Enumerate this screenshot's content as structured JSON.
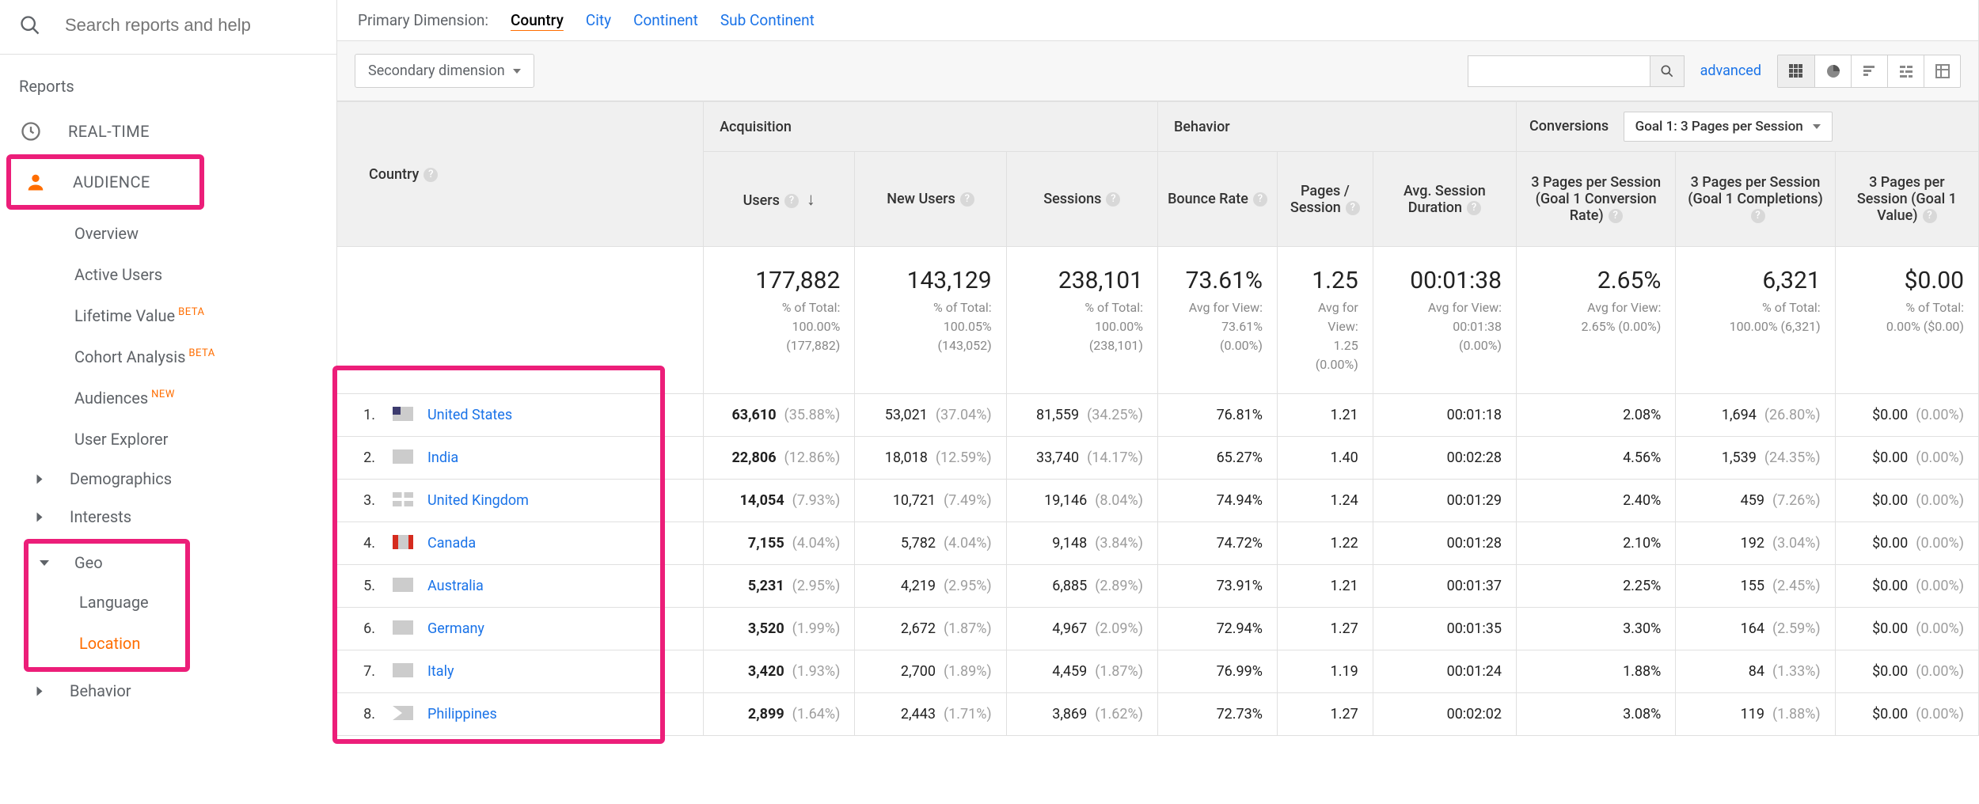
{
  "sidebar": {
    "search_placeholder": "Search reports and help",
    "reports_label": "Reports",
    "sections": {
      "realtime": "REAL-TIME",
      "audience": "AUDIENCE"
    },
    "audience_items": [
      {
        "label": "Overview",
        "badge": ""
      },
      {
        "label": "Active Users",
        "badge": ""
      },
      {
        "label": "Lifetime Value",
        "badge": "BETA"
      },
      {
        "label": "Cohort Analysis",
        "badge": "BETA"
      },
      {
        "label": "Audiences",
        "badge": "NEW"
      },
      {
        "label": "User Explorer",
        "badge": ""
      }
    ],
    "audience_expanders": [
      {
        "label": "Demographics"
      },
      {
        "label": "Interests"
      }
    ],
    "geo": {
      "label": "Geo",
      "items": [
        {
          "label": "Language"
        },
        {
          "label": "Location"
        }
      ]
    },
    "behavior_label": "Behavior"
  },
  "dimensions": {
    "label": "Primary Dimension:",
    "items": [
      "Country",
      "City",
      "Continent",
      "Sub Continent"
    ],
    "active": "Country"
  },
  "toolbar": {
    "secondary_dimension": "Secondary dimension",
    "advanced": "advanced"
  },
  "table": {
    "country_header": "Country",
    "groups": [
      "Acquisition",
      "Behavior",
      "Conversions"
    ],
    "goal_selected": "Goal 1: 3 Pages per Session",
    "metrics": [
      "Users",
      "New Users",
      "Sessions",
      "Bounce Rate",
      "Pages / Session",
      "Avg. Session Duration",
      "3 Pages per Session (Goal 1 Conversion Rate)",
      "3 Pages per Session (Goal 1 Completions)",
      "3 Pages per Session (Goal 1 Value)"
    ],
    "summary": [
      {
        "big": "177,882",
        "sub1": "% of Total:",
        "sub2": "100.00%",
        "sub3": "(177,882)"
      },
      {
        "big": "143,129",
        "sub1": "% of Total:",
        "sub2": "100.05%",
        "sub3": "(143,052)"
      },
      {
        "big": "238,101",
        "sub1": "% of Total:",
        "sub2": "100.00%",
        "sub3": "(238,101)"
      },
      {
        "big": "73.61%",
        "sub1": "Avg for View:",
        "sub2": "73.61%",
        "sub3": "(0.00%)"
      },
      {
        "big": "1.25",
        "sub1": "Avg for View:",
        "sub2": "1.25",
        "sub3": "(0.00%)"
      },
      {
        "big": "00:01:38",
        "sub1": "Avg for View:",
        "sub2": "00:01:38",
        "sub3": "(0.00%)"
      },
      {
        "big": "2.65%",
        "sub1": "Avg for View:",
        "sub2": "2.65% (0.00%)",
        "sub3": ""
      },
      {
        "big": "6,321",
        "sub1": "% of Total:",
        "sub2": "100.00% (6,321)",
        "sub3": ""
      },
      {
        "big": "$0.00",
        "sub1": "% of Total:",
        "sub2": "0.00% ($0.00)",
        "sub3": ""
      }
    ],
    "rows": [
      {
        "rank": "1.",
        "flag": "flag-us",
        "country": "United States",
        "users": "63,610",
        "users_pct": "(35.88%)",
        "nu": "53,021",
        "nu_pct": "(37.04%)",
        "sess": "81,559",
        "sess_pct": "(34.25%)",
        "br": "76.81%",
        "pps": "1.21",
        "dur": "00:01:18",
        "cr": "2.08%",
        "comp": "1,694",
        "comp_pct": "(26.80%)",
        "val": "$0.00",
        "val_pct": "(0.00%)"
      },
      {
        "rank": "2.",
        "flag": "flag-in",
        "country": "India",
        "users": "22,806",
        "users_pct": "(12.86%)",
        "nu": "18,018",
        "nu_pct": "(12.59%)",
        "sess": "33,740",
        "sess_pct": "(14.17%)",
        "br": "65.27%",
        "pps": "1.40",
        "dur": "00:02:28",
        "cr": "4.56%",
        "comp": "1,539",
        "comp_pct": "(24.35%)",
        "val": "$0.00",
        "val_pct": "(0.00%)"
      },
      {
        "rank": "3.",
        "flag": "flag-gb",
        "country": "United Kingdom",
        "users": "14,054",
        "users_pct": "(7.93%)",
        "nu": "10,721",
        "nu_pct": "(7.49%)",
        "sess": "19,146",
        "sess_pct": "(8.04%)",
        "br": "74.94%",
        "pps": "1.24",
        "dur": "00:01:29",
        "cr": "2.40%",
        "comp": "459",
        "comp_pct": "(7.26%)",
        "val": "$0.00",
        "val_pct": "(0.00%)"
      },
      {
        "rank": "4.",
        "flag": "flag-ca",
        "country": "Canada",
        "users": "7,155",
        "users_pct": "(4.04%)",
        "nu": "5,782",
        "nu_pct": "(4.04%)",
        "sess": "9,148",
        "sess_pct": "(3.84%)",
        "br": "74.72%",
        "pps": "1.22",
        "dur": "00:01:28",
        "cr": "2.10%",
        "comp": "192",
        "comp_pct": "(3.04%)",
        "val": "$0.00",
        "val_pct": "(0.00%)"
      },
      {
        "rank": "5.",
        "flag": "flag-au",
        "country": "Australia",
        "users": "5,231",
        "users_pct": "(2.95%)",
        "nu": "4,219",
        "nu_pct": "(2.95%)",
        "sess": "6,885",
        "sess_pct": "(2.89%)",
        "br": "73.91%",
        "pps": "1.21",
        "dur": "00:01:37",
        "cr": "2.25%",
        "comp": "155",
        "comp_pct": "(2.45%)",
        "val": "$0.00",
        "val_pct": "(0.00%)"
      },
      {
        "rank": "6.",
        "flag": "flag-de",
        "country": "Germany",
        "users": "3,520",
        "users_pct": "(1.99%)",
        "nu": "2,672",
        "nu_pct": "(1.87%)",
        "sess": "4,967",
        "sess_pct": "(2.09%)",
        "br": "72.94%",
        "pps": "1.27",
        "dur": "00:01:35",
        "cr": "3.30%",
        "comp": "164",
        "comp_pct": "(2.59%)",
        "val": "$0.00",
        "val_pct": "(0.00%)"
      },
      {
        "rank": "7.",
        "flag": "flag-it",
        "country": "Italy",
        "users": "3,420",
        "users_pct": "(1.93%)",
        "nu": "2,700",
        "nu_pct": "(1.89%)",
        "sess": "4,459",
        "sess_pct": "(1.87%)",
        "br": "76.99%",
        "pps": "1.19",
        "dur": "00:01:24",
        "cr": "1.88%",
        "comp": "84",
        "comp_pct": "(1.33%)",
        "val": "$0.00",
        "val_pct": "(0.00%)"
      },
      {
        "rank": "8.",
        "flag": "flag-ph",
        "country": "Philippines",
        "users": "2,899",
        "users_pct": "(1.64%)",
        "nu": "2,443",
        "nu_pct": "(1.71%)",
        "sess": "3,869",
        "sess_pct": "(1.62%)",
        "br": "72.73%",
        "pps": "1.27",
        "dur": "00:02:02",
        "cr": "3.08%",
        "comp": "119",
        "comp_pct": "(1.88%)",
        "val": "$0.00",
        "val_pct": "(0.00%)"
      }
    ]
  }
}
